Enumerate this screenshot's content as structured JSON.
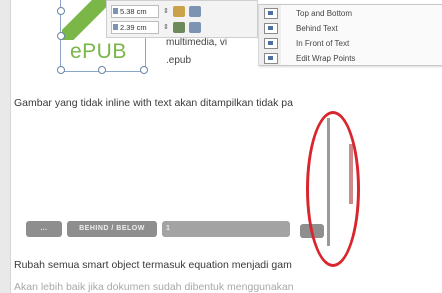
{
  "toolbar": {
    "height_value": "5.38 cm",
    "width_value": "2.39 cm"
  },
  "wrap_menu": {
    "items": [
      {
        "label": "Top and Bottom"
      },
      {
        "label": "Behind Text"
      },
      {
        "label": "In Front of Text"
      },
      {
        "label": "Edit Wrap Points"
      }
    ]
  },
  "object": {
    "logo_text": "ePUB",
    "caption_line1": "multimedia, vi",
    "caption_line2": ".epub"
  },
  "document": {
    "line1": "Gambar yang tidak inline with text akan ditampilkan tidak pa",
    "line2": "Rubah semua smart object termasuk equation menjadi gam",
    "line3": "Akan lebih baik jika dokumen sudah dibentuk menggunakan"
  },
  "pill_bar": {
    "pill1": "…",
    "pill2": "BEHIND / BELOW",
    "pill3": "1"
  },
  "colors": {
    "annotation": "#d9252d",
    "logo_green": "#7ab648"
  }
}
